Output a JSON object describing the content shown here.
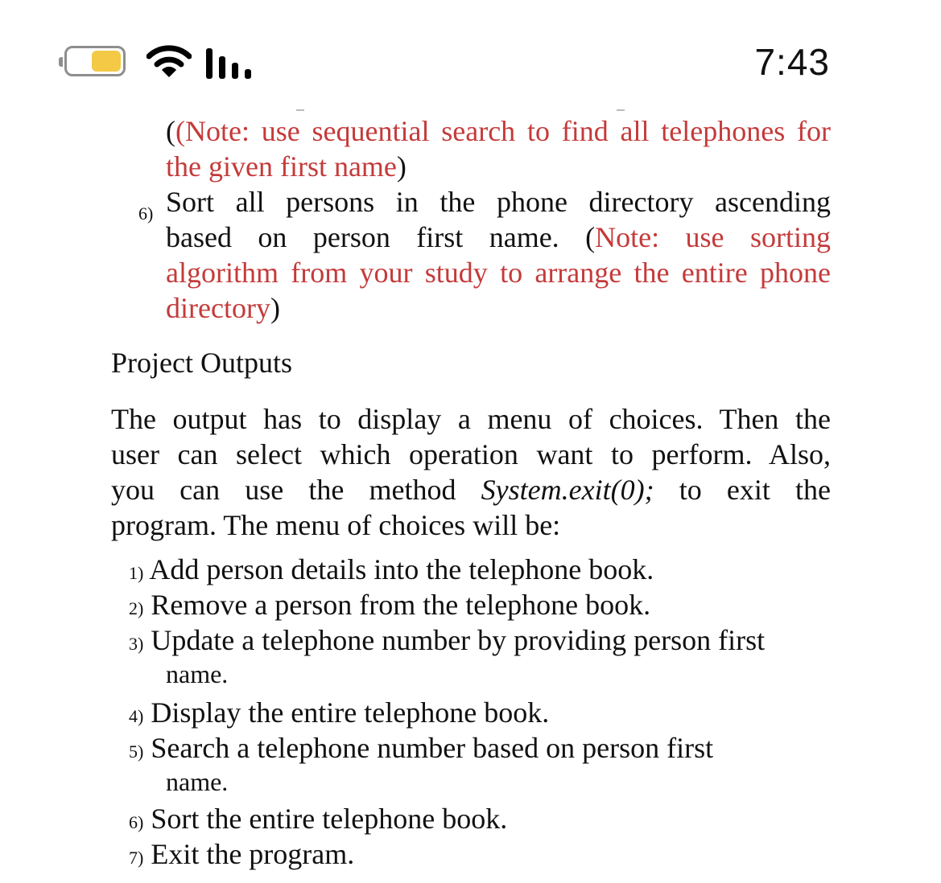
{
  "status_bar": {
    "time": "7:43",
    "battery_icon": "battery-icon",
    "wifi_icon": "wifi-icon",
    "signal_icon": "cellular-signal-icon",
    "battery_color": "#f3c946"
  },
  "colors": {
    "note_red": "#c53a3a",
    "text": "#111111"
  },
  "top_section": {
    "note5_line1": "(Note: use sequential search to find all telephones for",
    "note5_line2_red": "the given first name",
    "note5_line2_close": ")",
    "item6_number": "6)",
    "item6_line1": "Sort all persons in the phone directory ascending",
    "item6_line2_black": "based on person first name. (",
    "item6_line2_red": "Note: use sorting",
    "item6_line3_red": "algorithm from your study to arrange the entire phone",
    "item6_line4_red": "directory",
    "item6_line4_close": ")"
  },
  "project_outputs": {
    "heading": "Project Outputs",
    "para_line1": "The output has to display a menu of choices. Then the",
    "para_line2": "user can select which operation want to perform. Also,",
    "para_line3_a": "you can use the method",
    "para_line3_code": "System.exit(0);",
    "para_line3_b": "to exit the",
    "para_line4": "program. The menu of choices will be:"
  },
  "menu": [
    {
      "number": "1)",
      "text": "Add person details into the telephone book."
    },
    {
      "number": "2)",
      "text": "Remove a person from the telephone book."
    },
    {
      "number": "3)",
      "text": "Update a telephone number by providing person first",
      "cont": "name."
    },
    {
      "number": "4)",
      "text": "Display the entire telephone book."
    },
    {
      "number": "5)",
      "text": "Search a telephone number based on person first",
      "cont": "name."
    },
    {
      "number": "6)",
      "text": "Sort the entire telephone book."
    },
    {
      "number": "7)",
      "text": "Exit the program."
    }
  ]
}
